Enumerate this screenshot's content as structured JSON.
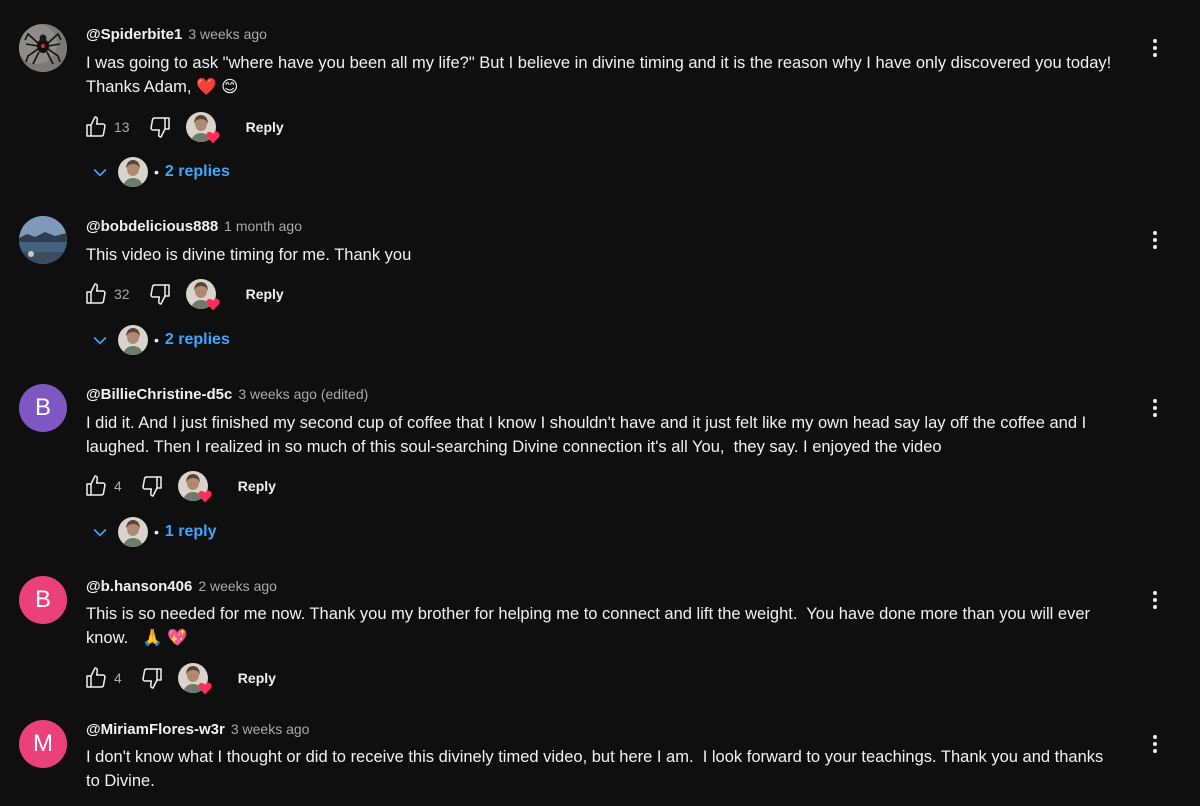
{
  "colors": {
    "background": "#0f0f0f",
    "link_blue": "#3ea6ff",
    "avatar_purple": "#7e57c2",
    "avatar_pink": "#ec407a",
    "heart_red": "#ff2d55"
  },
  "comments": [
    {
      "author": "@Spiderbite1",
      "time": "3 weeks ago",
      "text": "I was going to ask \"where have you been all my life?\" But I believe in divine timing and it is the reason why I have only discovered you today!\nThanks Adam, ❤️ 😊",
      "likes": "13",
      "reply_label": "Reply",
      "replies_label": "2 replies",
      "avatar_icon": "spider-photo"
    },
    {
      "author": "@bobdelicious888",
      "time": "1 month ago",
      "text": "This video is divine timing for me. Thank you",
      "likes": "32",
      "reply_label": "Reply",
      "replies_label": "2 replies",
      "avatar_icon": "landscape-photo"
    },
    {
      "author": "@BillieChristine-d5c",
      "time": "3 weeks ago (edited)",
      "text": "I did it. And I just finished my second cup of coffee that I know I shouldn't have and it just felt like my own head say lay off the coffee and I\nlaughed. Then I realized in so much of this soul-searching Divine connection it's all You,  they say. I enjoyed the video",
      "likes": "4",
      "reply_label": "Reply",
      "replies_label": "1 reply",
      "avatar_letter": "B"
    },
    {
      "author": "@b.hanson406",
      "time": "2 weeks ago",
      "text": "This is so needed for me now. Thank you my brother for helping me to connect and lift the weight.  You have done more than you will ever\nknow.   🙏 💖",
      "likes": "4",
      "reply_label": "Reply",
      "avatar_letter": "B"
    },
    {
      "author": "@MiriamFlores-w3r",
      "time": "3 weeks ago",
      "text": "I don't know what I thought or did to receive this divinely timed video, but here I am.  I look forward to your teachings. Thank you and thanks\nto Divine.",
      "avatar_letter": "M"
    }
  ]
}
